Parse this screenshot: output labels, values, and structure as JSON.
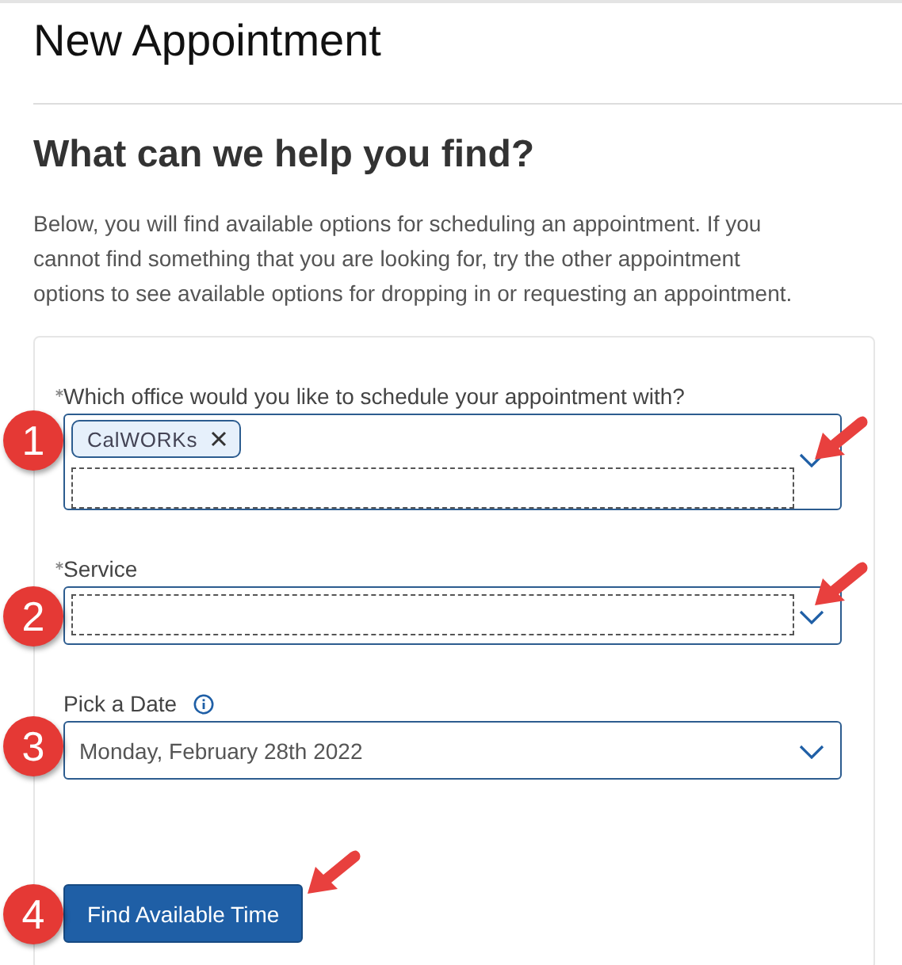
{
  "page_title": "New Appointment",
  "section": {
    "heading": "What can we help you find?",
    "intro": "Below, you will find available options for scheduling an appointment. If you cannot find something that you are looking for, try the other appointment options to see available options for dropping in or requesting an appointment."
  },
  "form": {
    "fields": [
      {
        "kind": "multiselect",
        "label": "Which office would you like to schedule your appointment with?",
        "required": true,
        "tags": [
          "CalWORKs"
        ]
      },
      {
        "kind": "select",
        "label": "Service",
        "required": true
      },
      {
        "kind": "date",
        "label": "Pick a Date",
        "required": false,
        "info": true,
        "value": "Monday, February 28th 2022"
      }
    ],
    "submit": "Find Available Time"
  },
  "callouts": [
    {
      "number": "1",
      "arrow": true
    },
    {
      "number": "2",
      "arrow": true
    },
    {
      "number": "3",
      "arrow": false
    },
    {
      "number": "4",
      "arrow": true
    }
  ]
}
